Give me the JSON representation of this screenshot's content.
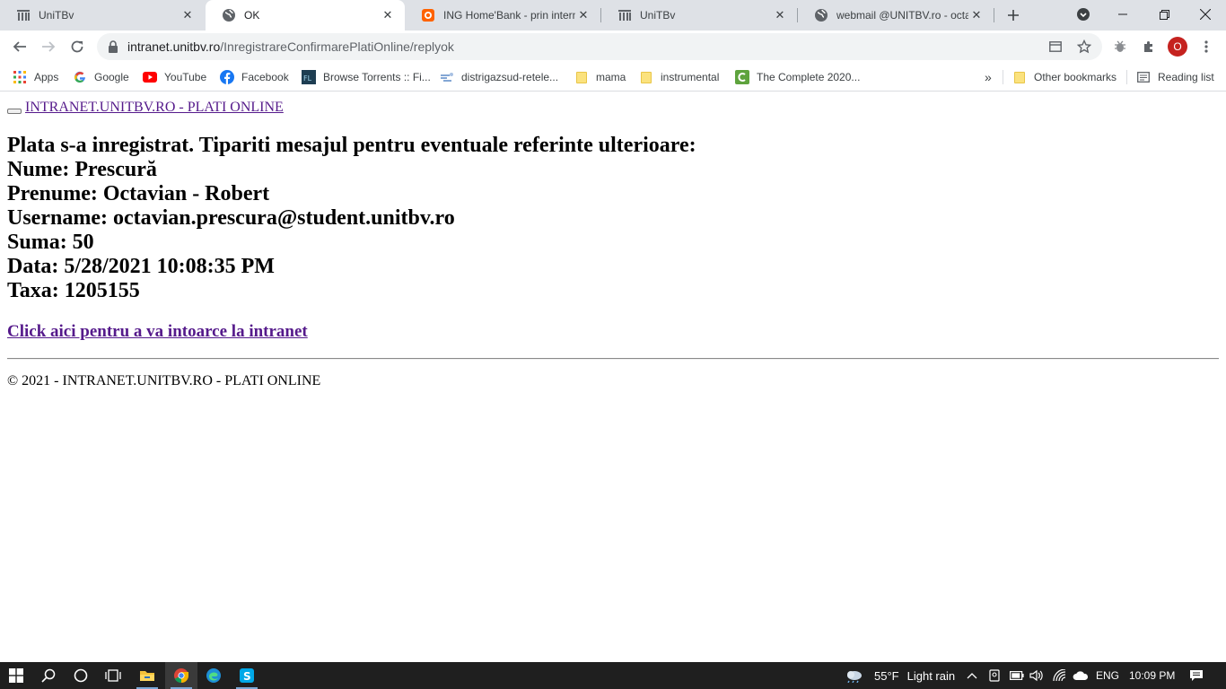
{
  "tabs": [
    {
      "title": "UniTBv",
      "icon": "building-icon"
    },
    {
      "title": "OK",
      "icon": "globe-icon"
    },
    {
      "title": "ING Home'Bank - prin interne",
      "icon": "ing-lion-icon"
    },
    {
      "title": "UniTBv",
      "icon": "building-icon"
    },
    {
      "title": "webmail @UNITBV.ro - octav",
      "icon": "globe-icon"
    }
  ],
  "address": {
    "host": "intranet.unitbv.ro",
    "path": "/InregistrareConfirmarePlatiOnline/replyok"
  },
  "profile_initial": "O",
  "bookmarks": [
    {
      "label": "Apps",
      "icon": "apps-grid-icon"
    },
    {
      "label": "Google",
      "icon": "google-icon"
    },
    {
      "label": "YouTube",
      "icon": "youtube-icon"
    },
    {
      "label": "Facebook",
      "icon": "facebook-icon"
    },
    {
      "label": "Browse Torrents :: Fi...",
      "icon": "filelist-icon"
    },
    {
      "label": "distrigazsud-retele...",
      "icon": "gas-icon"
    },
    {
      "label": "mama",
      "icon": "folder-icon"
    },
    {
      "label": "instrumental",
      "icon": "folder-icon"
    },
    {
      "label": "The Complete 2020...",
      "icon": "course-icon"
    }
  ],
  "bookmarks_more": "»",
  "other_bookmarks": "Other bookmarks",
  "reading_list": "Reading list",
  "page": {
    "brand_link": "INTRANET.UNITBV.RO - PLATI ONLINE",
    "lines": [
      "Plata s-a inregistrat. Tipariti mesajul pentru eventuale referinte ulterioare:",
      "Nume: Prescură",
      "Prenume: Octavian - Robert",
      "Username: octavian.prescura@student.unitbv.ro",
      "Suma: 50",
      "Data: 5/28/2021 10:08:35 PM",
      "Taxa: 1205155"
    ],
    "back_link": "Click aici pentru a va intoarce la intranet",
    "footer": "© 2021 - INTRANET.UNITBV.RO - PLATI ONLINE"
  },
  "taskbar": {
    "weather_temp": "55°F",
    "weather_text": "Light rain",
    "language": "ENG",
    "time": "10:09 PM"
  }
}
